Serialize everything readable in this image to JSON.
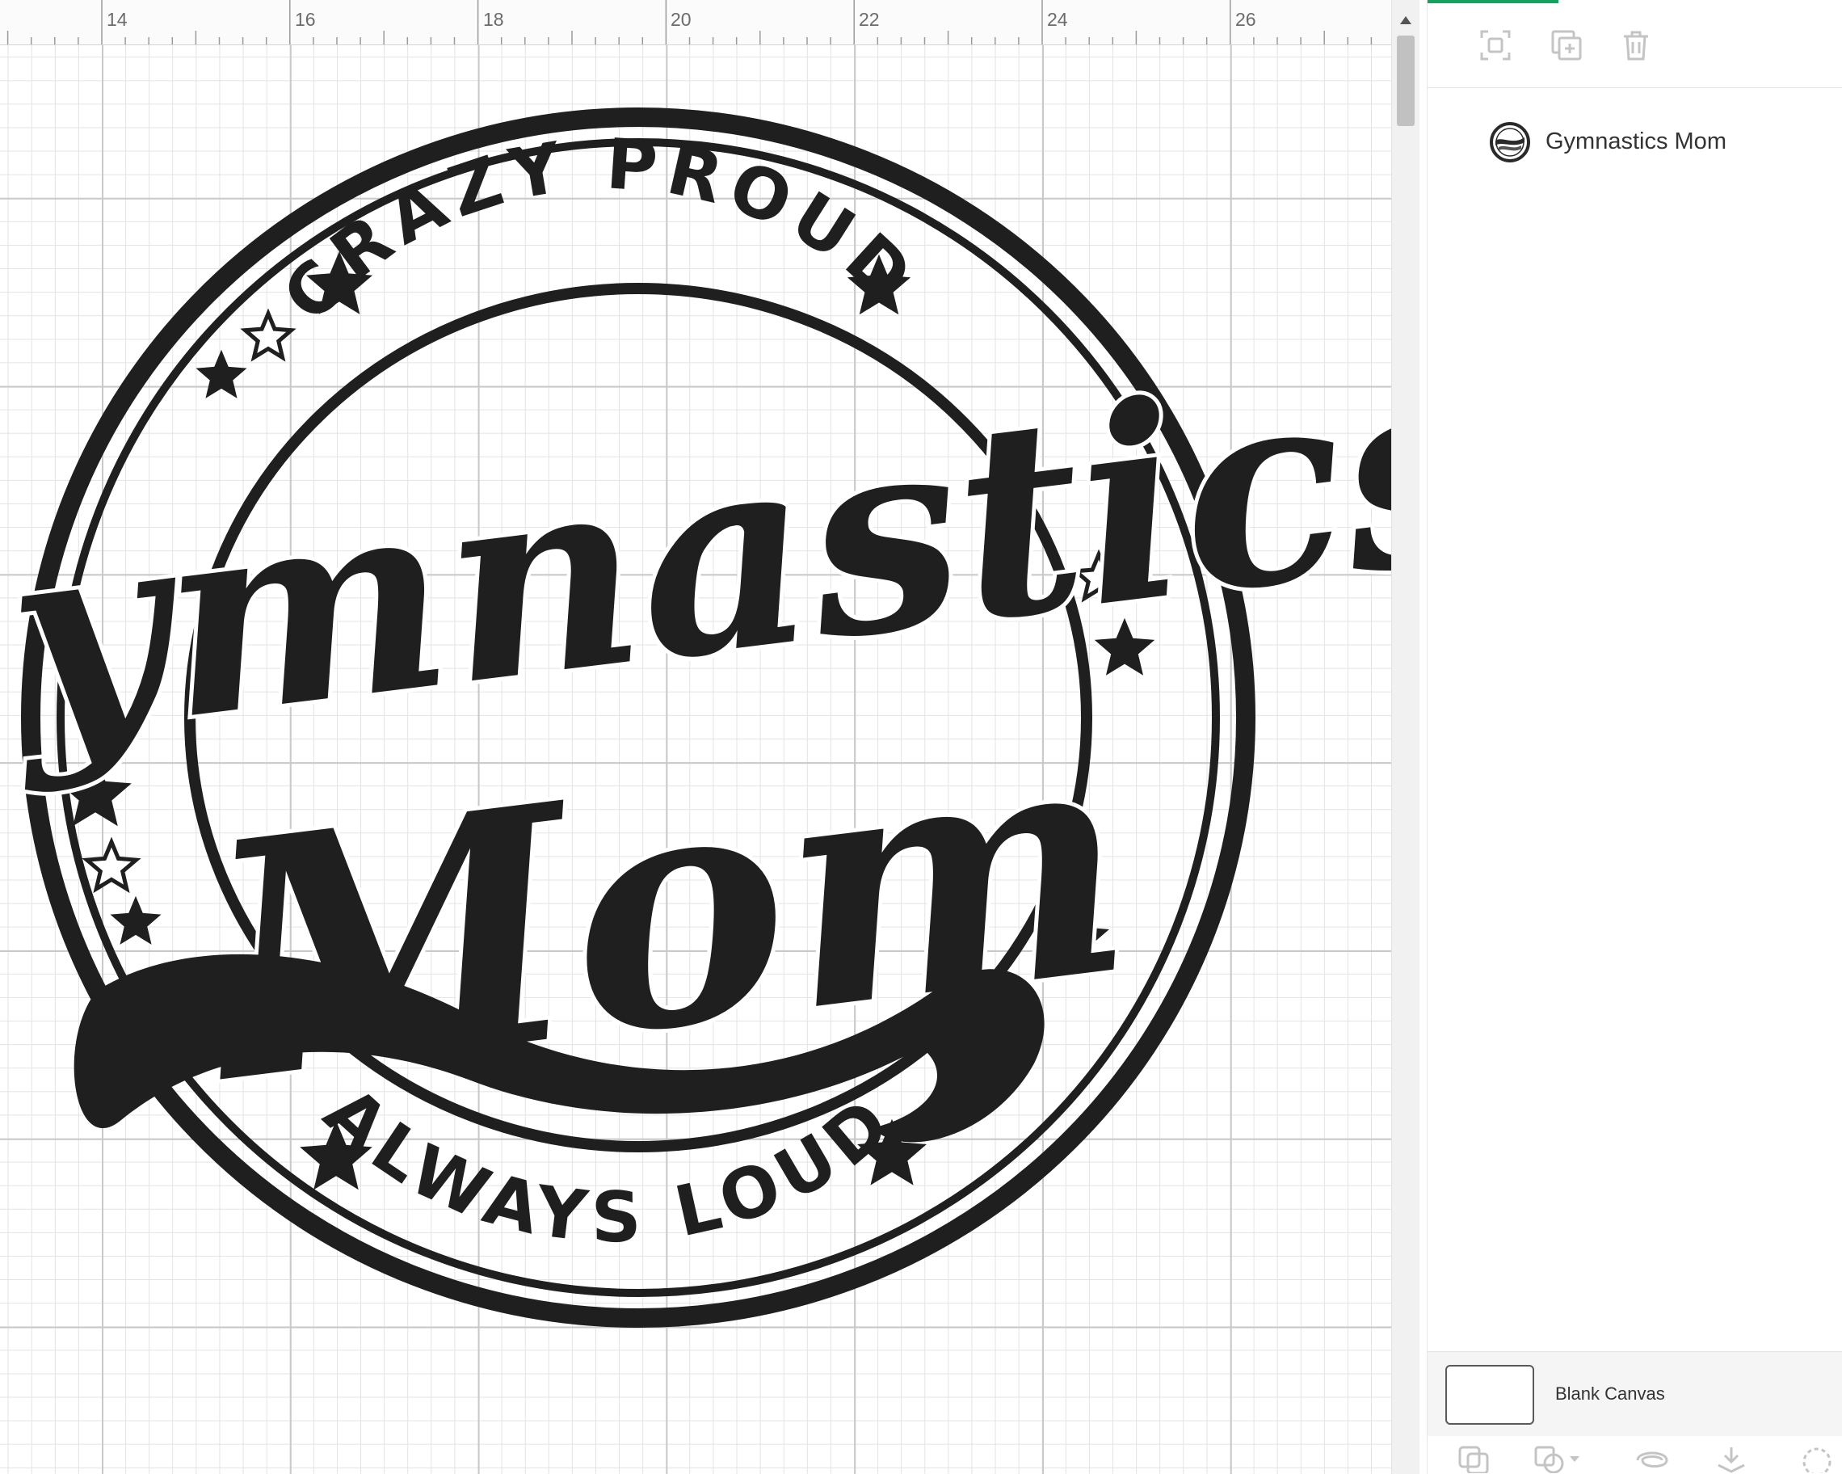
{
  "ruler": {
    "ticks": [
      "14",
      "16",
      "18",
      "20",
      "22",
      "24",
      "26"
    ]
  },
  "design": {
    "top_text": "CRAZY PROUD",
    "main_word": "Gymnastics",
    "second_word": "Mom",
    "bottom_text": "ALWAYS LOUD",
    "ink_color": "#1f1f1f"
  },
  "panel": {
    "accent_color": "#18a05e",
    "toolbar": {
      "group_icon": "group-icon",
      "duplicate_icon": "duplicate-icon",
      "delete_icon": "trash-icon"
    },
    "layers": [
      {
        "name": "Gymnastics Mom",
        "thumb_icon": "layer-thumbnail"
      }
    ],
    "canvas": {
      "label": "Blank Canvas"
    },
    "bottom_icons": [
      "slice-icon",
      "combine-icon",
      "attach-icon",
      "flatten-icon",
      "contour-icon"
    ]
  }
}
